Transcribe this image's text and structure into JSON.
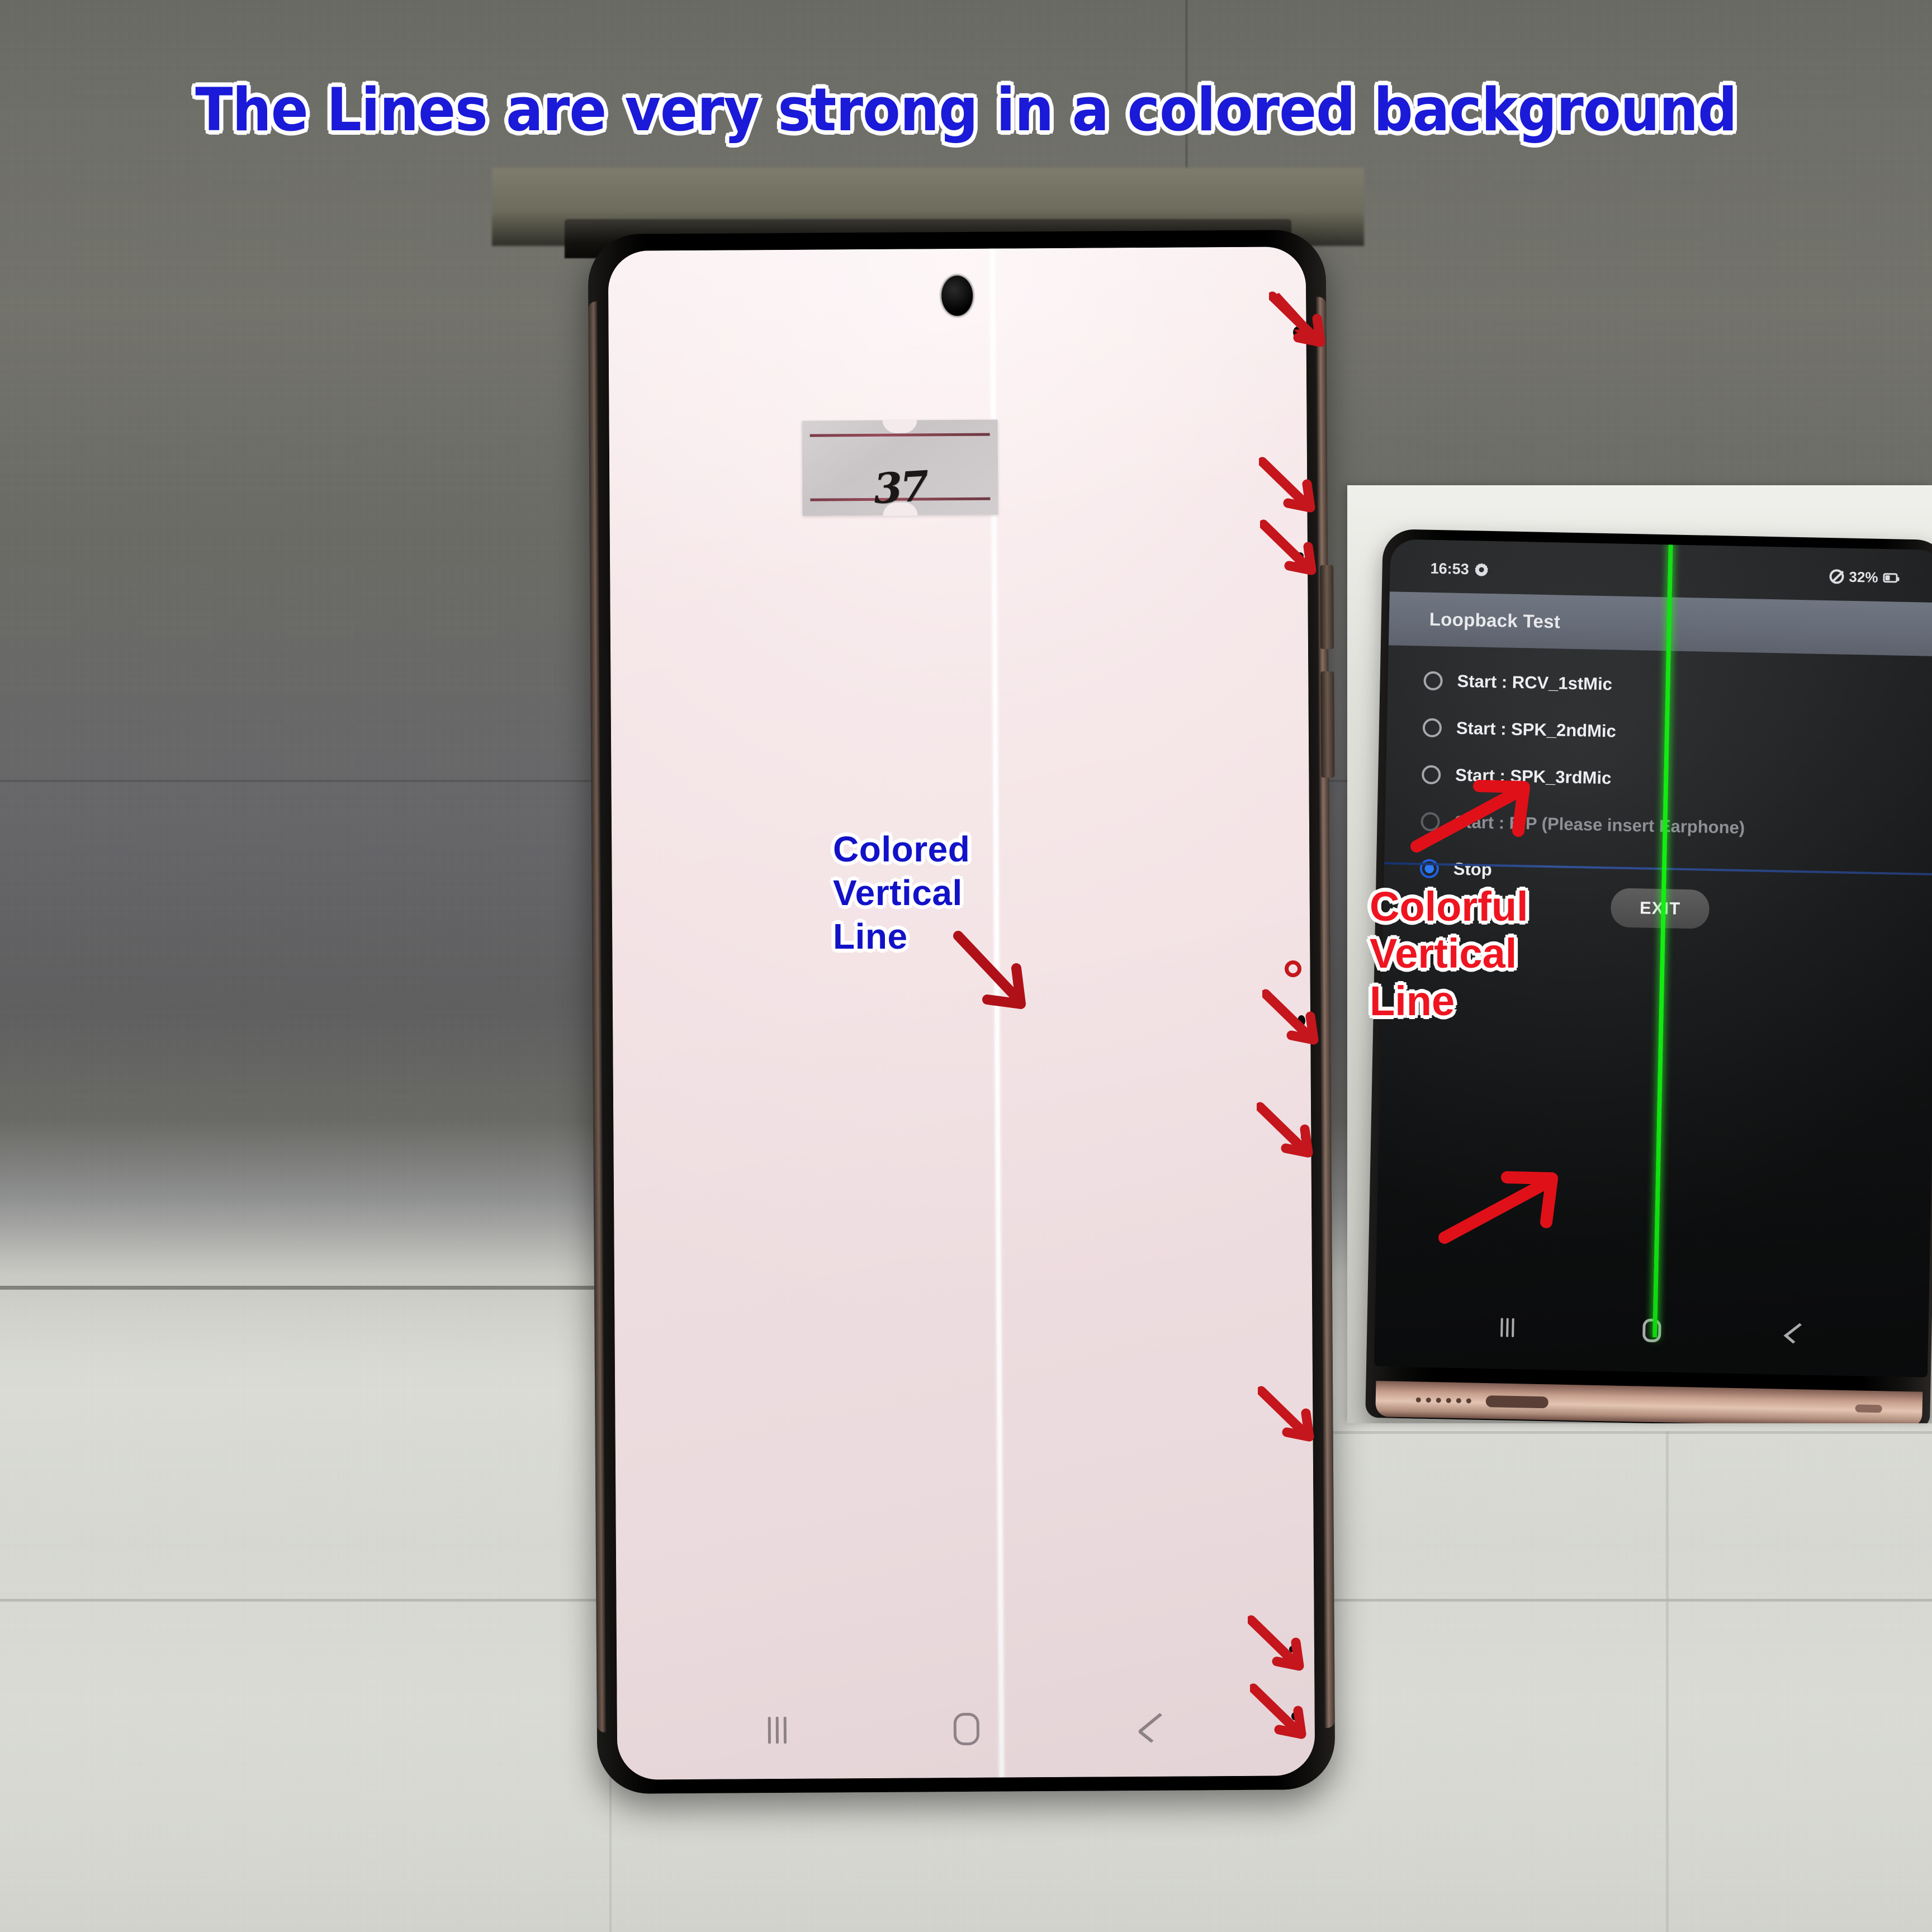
{
  "title": "The Lines are very strong in a colored background",
  "colors": {
    "title_blue": "#1a1ad8",
    "annotation_blue": "#1212c8",
    "annotation_red": "#ee1520",
    "arrow_red": "#c4161c",
    "defect_line_white": "#ffffff",
    "defect_line_green": "#12f012",
    "radio_selected_blue": "#2b7bf5",
    "phone_frame_copper": "#c79f8d"
  },
  "main_phone": {
    "annotation": {
      "line1": "Colored",
      "line2": "Vertical",
      "line3": "Line"
    },
    "sticker": {
      "handwriting": "37"
    },
    "nav_bar": {
      "recents_label": "Recents",
      "home_label": "Home",
      "back_label": "Back"
    },
    "defect_markers": {
      "arrow_count": 7,
      "circle_count": 1,
      "description": "Red arrows pointing to dead pixel dots along right edge"
    }
  },
  "inset_phone": {
    "status_bar": {
      "time": "16:53",
      "gear_icon": "gear-icon",
      "mute_icon": "mute-icon",
      "battery_percent": "32%",
      "battery_icon": "battery-icon"
    },
    "app_bar": {
      "title": "Loopback Test"
    },
    "options": [
      {
        "label": "Start : RCV_1stMic",
        "selected": false,
        "dimmed": false
      },
      {
        "label": "Start : SPK_2ndMic",
        "selected": false,
        "dimmed": false
      },
      {
        "label": "Start : SPK_3rdMic",
        "selected": false,
        "dimmed": false
      },
      {
        "label": "Start : E/P (Please insert Earphone)",
        "selected": false,
        "dimmed": true
      },
      {
        "label": "Stop",
        "selected": true,
        "dimmed": false
      }
    ],
    "exit_button": "EXIT",
    "annotation": {
      "line1": "Colorful",
      "line2": "Vertical",
      "line3": "Line"
    },
    "nav_bar": {
      "recents_label": "Recents",
      "home_label": "Home",
      "back_label": "Back"
    }
  }
}
